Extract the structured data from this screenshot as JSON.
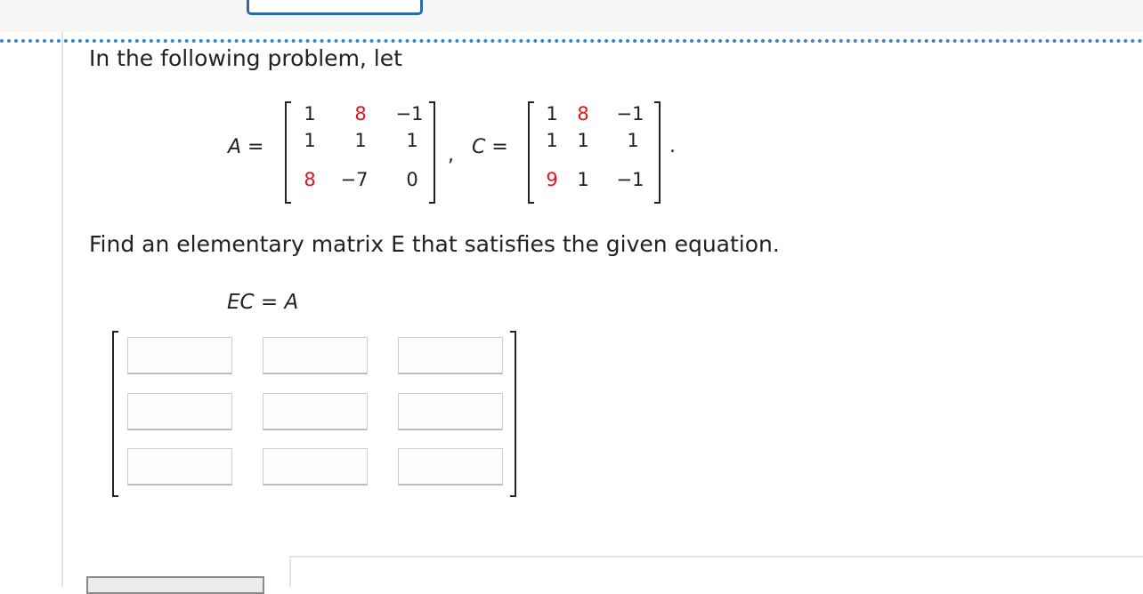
{
  "problem": {
    "intro": "In the following problem, let",
    "a_label": "A =",
    "c_label": "C =",
    "comma": ",",
    "period": ".",
    "matrix_a": {
      "r1c1": "1",
      "r1c2": "8",
      "r1c3": "−1",
      "r2c1": "1",
      "r2c2": "1",
      "r2c3": "1",
      "r3c1": "8",
      "r3c2": "−7",
      "r3c3": "0"
    },
    "matrix_c": {
      "r1c1": "1",
      "r1c2": "8",
      "r1c3": "−1",
      "r2c1": "1",
      "r2c2": "1",
      "r2c3": "1",
      "r3c1": "9",
      "r3c2": "1",
      "r3c3": "−1"
    },
    "highlight_color": "#e3141b",
    "instruction": "Find an elementary matrix E that satisfies the given equation.",
    "equation": "EC = A"
  },
  "answer": {
    "matrix_e": [
      [
        "",
        "",
        ""
      ],
      [
        "",
        "",
        ""
      ],
      [
        "",
        "",
        ""
      ]
    ]
  },
  "colors": {
    "accent_dotted": "#3b86c8",
    "tab_border": "#2c6ba3"
  }
}
